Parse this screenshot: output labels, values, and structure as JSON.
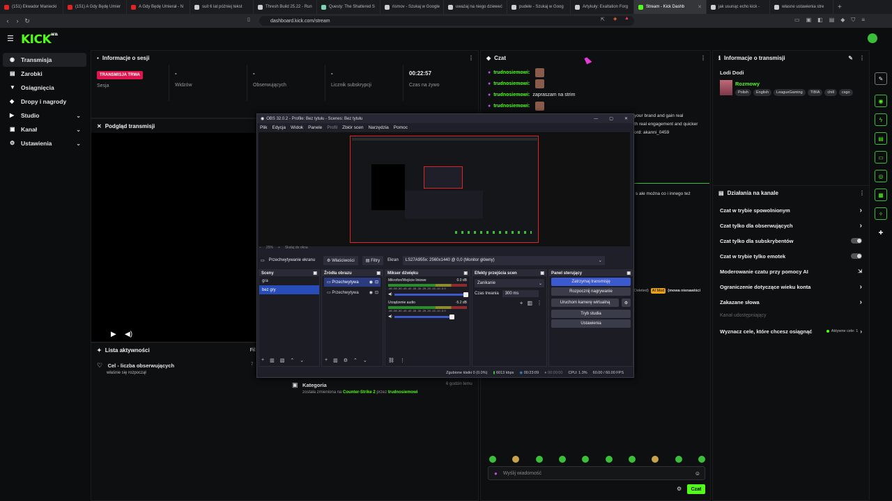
{
  "browser": {
    "tabs": [
      {
        "label": "(151) Ekwador Maniecki",
        "color": "#e02424"
      },
      {
        "label": "(151) A Gdy Będę Umier",
        "color": "#e02424"
      },
      {
        "label": "A Gdy Będę Umierał - N",
        "color": "#e02424"
      },
      {
        "label": "suit 6 lat później tekst",
        "color": "#cfcfcf"
      },
      {
        "label": "Thresh Build 25.22 - Run",
        "color": "#cfcfcf"
      },
      {
        "label": "Questy: The Shattered S",
        "color": "#7bd3b0"
      },
      {
        "label": "rismov - Szukaj w Google",
        "color": "#cfcfcf"
      },
      {
        "label": "uważaj na niego dzieweć",
        "color": "#cfcfcf"
      },
      {
        "label": "pudełe - Szukaj w Goog",
        "color": "#cfcfcf"
      },
      {
        "label": "Artykuły: Exaltation Forg",
        "color": "#cfcfcf"
      },
      {
        "label": "Stream - Kick Dashb",
        "color": "#53fc18",
        "active": true
      },
      {
        "label": "jak usunąc echo kick -",
        "color": "#cfcfcf"
      },
      {
        "label": "własne ustawienia stre",
        "color": "#cfcfcf"
      }
    ],
    "new_tab": "+",
    "url": "dashboard.kick.com/stream"
  },
  "app": {
    "logo": "KICK",
    "logo_badge": "BETA"
  },
  "sidebar": {
    "items": [
      {
        "label": "Transmisja",
        "icon": "broadcast-icon"
      },
      {
        "label": "Zarobki",
        "icon": "wallet-icon"
      },
      {
        "label": "Osiągnięcia",
        "icon": "trophy-icon"
      },
      {
        "label": "Dropy i nagrody",
        "icon": "gift-icon"
      },
      {
        "label": "Studio",
        "icon": "studio-icon",
        "chev": "⌄"
      },
      {
        "label": "Kanał",
        "icon": "channel-icon",
        "chev": "⌄"
      },
      {
        "label": "Ustawienia",
        "icon": "gear-icon",
        "chev": "⌄"
      }
    ]
  },
  "session": {
    "title": "Informacje o sesji",
    "live_badge": "TRANSMISJA TRWA",
    "session_label": "Sesja",
    "stats": [
      {
        "value": "-",
        "label": "Widzów"
      },
      {
        "value": "-",
        "label": "Obserwujących"
      },
      {
        "value": "-",
        "label": "Licznik subskrypcji"
      },
      {
        "value": "00:22:57",
        "label": "Czas na żywo"
      }
    ]
  },
  "preview": {
    "title": "Podgląd transmisji"
  },
  "activity": {
    "title": "Lista aktywności",
    "filter": "Fil",
    "items": [
      {
        "title": "Cel - liczba obserwujących",
        "sub": "właśnie się rozpoczął",
        "time": "7"
      }
    ],
    "category": {
      "title": "Kategoria",
      "prefix": "została zmieniona na",
      "game": "Counter-Strike 2",
      "by": "przez",
      "user": "trudnosiemowi",
      "time": "6 godzin temu"
    }
  },
  "chat": {
    "title": "Czat",
    "messages": [
      {
        "user": "trudnosiemowi:",
        "text": ""
      },
      {
        "user": "trudnosiemowi:",
        "text": ""
      },
      {
        "user": "trudnosiemowi:",
        "text": "zapraszam na strim"
      },
      {
        "user": "trudnosiemowi:",
        "text": ""
      }
    ],
    "overflow_lines": [
      "your brand and gain real",
      "th real engagement and quicker",
      "ord: akanni_0459"
    ],
    "extra": "s ale można co i innego też",
    "deleted": "Deleted)",
    "ai_tag": "AI Mod",
    "deleted_note": "(mowa nienawiści",
    "placeholder": "Wyślij wiadomość",
    "send": "Czat"
  },
  "stream_info": {
    "title": "Informacje o transmisji",
    "stream_title": "Lodi Dodi",
    "category": "Rozmowy",
    "tags": [
      "Polish",
      "English",
      "LeagueGaming",
      "TIBIA",
      "chill",
      "csgo"
    ]
  },
  "channel_actions": {
    "title": "Działania na kanale",
    "items": [
      {
        "label": "Czat w trybie spowolnionym",
        "ctrl": "chevron"
      },
      {
        "label": "Czat tylko dla obserwujących",
        "ctrl": "chevron"
      },
      {
        "label": "Czat tylko dla subskrybentów",
        "ctrl": "toggle"
      },
      {
        "label": "Czat w trybie tylko emotek",
        "ctrl": "toggle"
      },
      {
        "label": "Moderowanie czatu przy pomocy AI",
        "ctrl": "external"
      },
      {
        "label": "Ograniczenie dotyczące wieku konta",
        "ctrl": "chevron"
      },
      {
        "label": "Zakazane słowa",
        "ctrl": "chevron"
      }
    ],
    "muted": "Kanał udostępniający",
    "goals_label": "Wyznacz cele, które chcesz osiągnąć",
    "goals_active": "Aktywne cele: 1"
  },
  "obs": {
    "title": "OBS 32.0.2 - Profile: Bez tytułu - Scenes: Bez tytułu",
    "menu": [
      "Plik",
      "Edycja",
      "Widok",
      "Panele",
      "Profil",
      "Zbiór scen",
      "Narzędzia",
      "Pomoc"
    ],
    "zoom": "25%",
    "scale": "Skaluj do okna",
    "source_bar": {
      "name": "Przechwytywanie ekranu",
      "props": "Właściwości",
      "filters": "Filtry",
      "screen_label": "Ekran",
      "screen_value": "LS27A955x: 2560x1440 @ 0,0 (Monitor główny)"
    },
    "scenes": {
      "title": "Sceny",
      "items": [
        "gra",
        "bez gry"
      ]
    },
    "sources": {
      "title": "Źródła obrazu",
      "items": [
        "Przechwytywa",
        "Przechwytywa"
      ]
    },
    "mixer": {
      "title": "Mikser dźwięku",
      "channels": [
        {
          "name": "Mikrofon/Wejście liniowe",
          "db": "0.0 dB"
        },
        {
          "name": "Urządzenie audio",
          "db": "-5.2 dB"
        }
      ],
      "scale": "-60 -55 -50 -45 -40 -35 -30 -25 -20 -15 -10 -5 0"
    },
    "transitions": {
      "title": "Efekty przejścia scen",
      "value": "Zanikanie",
      "duration_label": "Czas trwania",
      "duration": "300 ms"
    },
    "controls": {
      "title": "Panel sterujący",
      "buttons": [
        "Zatrzymaj transmisję",
        "Rozpocznij nagrywanie",
        "Uruchom kamerę wirtualną",
        "Tryb studia",
        "Ustawienia"
      ]
    },
    "status": {
      "dropped": "Zgubione klatki 0 (0.0%)",
      "bitrate": "6013 kbps",
      "live": "00:23:09",
      "rec": "00:00:00",
      "cpu": "CPU: 1.3%",
      "fps": "60.00 / 60.00 FPS"
    }
  }
}
